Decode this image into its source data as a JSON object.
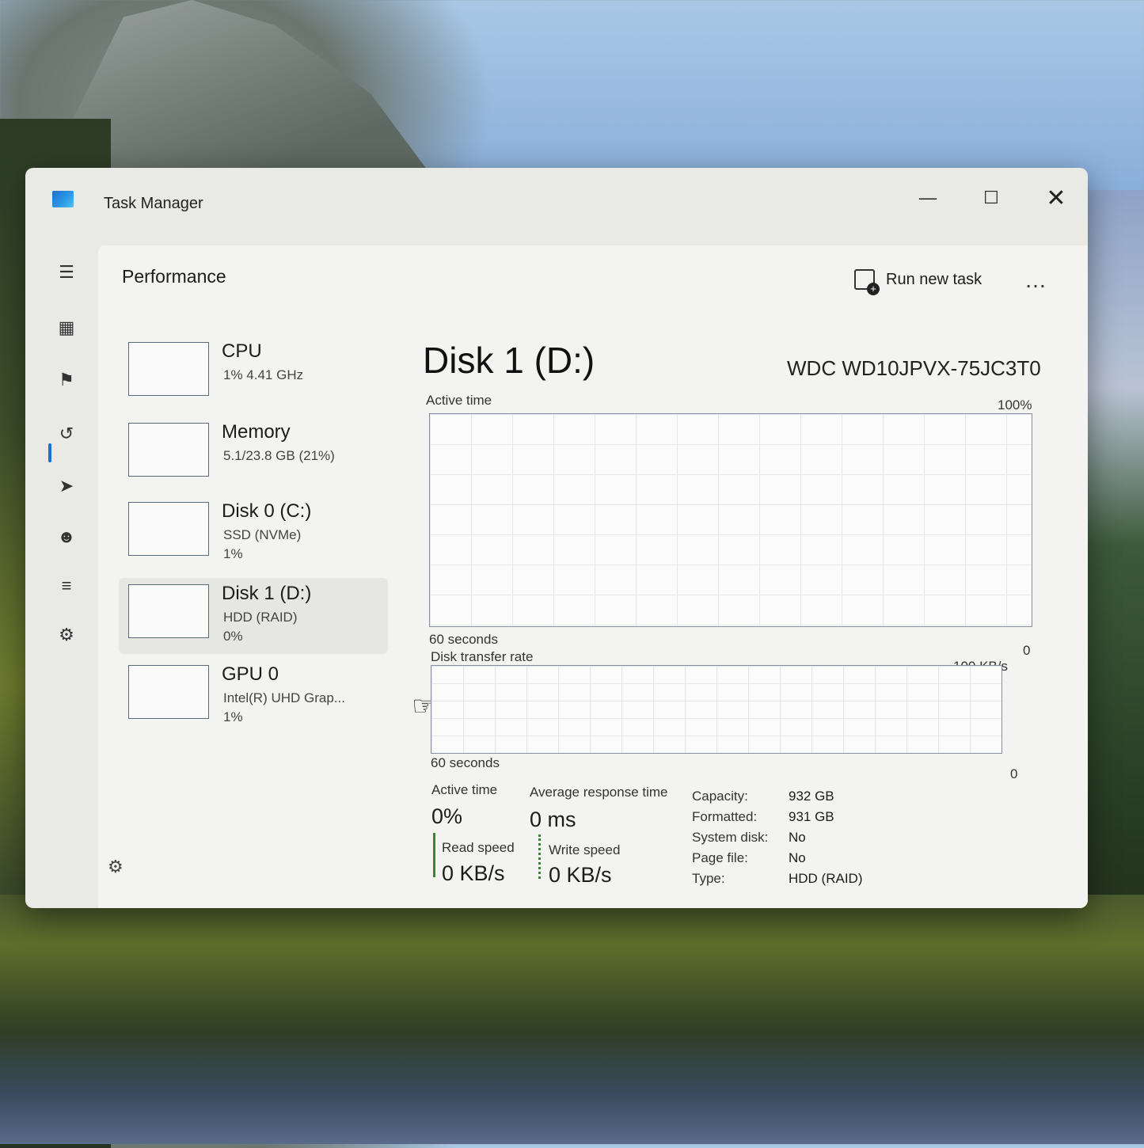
{
  "window": {
    "title": "Task Manager",
    "minimize_label": "—",
    "maximize_label": "☐",
    "close_label": "✕"
  },
  "header": {
    "page_title": "Performance",
    "run_new_task": "Run new task",
    "more": "…"
  },
  "devices": [
    {
      "name": "CPU",
      "sub": "1% 4.41 GHz",
      "sub2": ""
    },
    {
      "name": "Memory",
      "sub": "5.1/23.8 GB (21%)",
      "sub2": ""
    },
    {
      "name": "Disk 0 (C:)",
      "sub": "SSD (NVMe)",
      "sub2": "1%"
    },
    {
      "name": "Disk 1 (D:)",
      "sub": "HDD (RAID)",
      "sub2": "0%"
    },
    {
      "name": "GPU 0",
      "sub": "Intel(R) UHD Grap...",
      "sub2": "1%"
    }
  ],
  "selected_device_index": 3,
  "detail": {
    "title": "Disk 1 (D:)",
    "model": "WDC WD10JPVX-75JC3T0",
    "active_chart": {
      "label": "Active time",
      "max": "100%",
      "time_span": "60 seconds",
      "min": "0"
    },
    "transfer_chart": {
      "label": "Disk transfer rate",
      "max": "100 KB/s",
      "time_span": "60 seconds",
      "min": "0"
    },
    "stats": {
      "active_time_label": "Active time",
      "active_time_value": "0%",
      "avg_response_label": "Average response time",
      "avg_response_value": "0 ms",
      "read_speed_label": "Read speed",
      "read_speed_value": "0 KB/s",
      "write_speed_label": "Write speed",
      "write_speed_value": "0 KB/s"
    },
    "info": [
      {
        "key": "Capacity:",
        "value": "932 GB"
      },
      {
        "key": "Formatted:",
        "value": "931 GB"
      },
      {
        "key": "System disk:",
        "value": "No"
      },
      {
        "key": "Page file:",
        "value": "No"
      },
      {
        "key": "Type:",
        "value": "HDD (RAID)"
      }
    ]
  },
  "nav_icons": [
    "hamburger-icon",
    "processes-icon",
    "performance-icon",
    "app-history-icon",
    "startup-apps-icon",
    "users-icon",
    "details-icon",
    "services-icon",
    "settings-icon"
  ],
  "colors": {
    "accent": "#1a6fd8",
    "speed_indicator": "#3f7f3f"
  }
}
